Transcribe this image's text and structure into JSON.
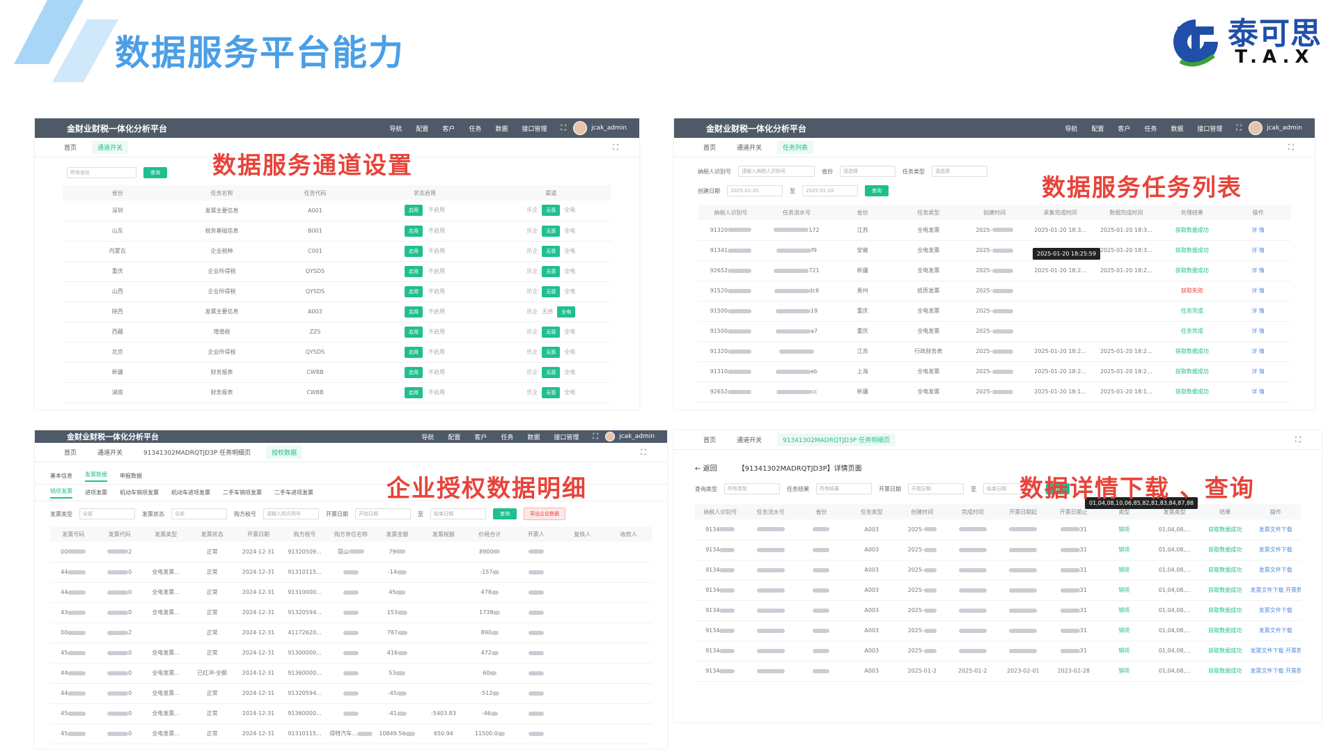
{
  "slide": {
    "title": "数据服务平台能力"
  },
  "logo": {
    "cn": "泰可思",
    "en": "T.A.X",
    "brand_color": "#1f4fa8",
    "accent_green": "#3aa335"
  },
  "colors": {
    "title": "#4a9fe6",
    "overlay": "#e8433a",
    "topbar": "#4e5a68",
    "accent": "#1fbf8f"
  },
  "app": {
    "name": "金财业财税一体化分析平台",
    "nav": [
      "导航",
      "配置",
      "客户",
      "任务",
      "数据",
      "接口管理"
    ],
    "user": "jcak_admin"
  },
  "panel1": {
    "overlay": "数据服务通道设置",
    "tabs": [
      "首页",
      "通道开关"
    ],
    "filter": {
      "placeholder": "所有省份",
      "button": "查询"
    },
    "headers": [
      "省份",
      "任务名称",
      "任务代码",
      "状态启用",
      "渠道"
    ],
    "rows": [
      {
        "province": "深圳",
        "task": "发票主要信息",
        "code": "A001"
      },
      {
        "province": "山东",
        "task": "税务基础信息",
        "code": "B001"
      },
      {
        "province": "内蒙古",
        "task": "企业税种",
        "code": "C001"
      },
      {
        "province": "重庆",
        "task": "企业所得税",
        "code": "QYSDS"
      },
      {
        "province": "山西",
        "task": "企业所得税",
        "code": "QYSDS"
      },
      {
        "province": "陕西",
        "task": "发票主要信息",
        "code": "A003"
      },
      {
        "province": "西藏",
        "task": "增值税",
        "code": "ZZS"
      },
      {
        "province": "北京",
        "task": "企业所得税",
        "code": "QYSDS"
      },
      {
        "province": "新疆",
        "task": "财务报表",
        "code": "CWBB"
      },
      {
        "province": "湖南",
        "task": "财务报表",
        "code": "CWBB"
      }
    ],
    "btn_on": "启用",
    "btn_off": "不启用",
    "channel_a": "乐企",
    "channel_b": "无感",
    "channel_c": "全电",
    "channel_alt": "无感"
  },
  "panel2": {
    "overlay": "数据服务任务列表",
    "tabs": [
      "首页",
      "通道开关",
      "任务列表"
    ],
    "filter": {
      "taxid_label": "纳税人识别号",
      "taxid_placeholder": "请输入纳税人识别号",
      "province_label": "省份",
      "province_placeholder": "请选择",
      "type_label": "任务类型",
      "type_placeholder": "请选择",
      "date_label": "创建日期",
      "date_from": "2025-01-20",
      "date_sep": "至",
      "date_to": "2025-01-20",
      "button": "查询"
    },
    "headers": [
      "纳税人识别号",
      "任务流水号",
      "省份",
      "任务类型",
      "创建时间",
      "采集完成时间",
      "数据完成时间",
      "处理结果",
      "操作"
    ],
    "tooltip": "2025-01-20 18:25:59",
    "rows": [
      {
        "id": "91320",
        "serial": "172",
        "prov": "江苏",
        "type": "全电发票",
        "created": "2025-",
        "collect": "2025-01-20 18:3...",
        "done": "2025-01-20 18:3...",
        "status": "获取数据成功",
        "status_cls": "st-green"
      },
      {
        "id": "91341",
        "serial": "f9",
        "prov": "安徽",
        "type": "全电发票",
        "created": "2025-",
        "collect": "",
        "done": "2025-01-20 18:3...",
        "status": "获取数据成功",
        "status_cls": "st-green"
      },
      {
        "id": "92652",
        "serial": "721",
        "prov": "新疆",
        "type": "全电发票",
        "created": "2025-",
        "collect": "2025-01-20 18:2...",
        "done": "2025-01-20 18:2...",
        "status": "获取数据成功",
        "status_cls": "st-green"
      },
      {
        "id": "91520",
        "serial": "dc6",
        "prov": "贵州",
        "type": "纸质发票",
        "created": "2025-",
        "collect": "",
        "done": "",
        "status": "获取失败",
        "status_cls": "st-red"
      },
      {
        "id": "91500",
        "serial": "19",
        "prov": "重庆",
        "type": "全电发票",
        "created": "2025-",
        "collect": "",
        "done": "",
        "status": "任务完成",
        "status_cls": "st-green"
      },
      {
        "id": "91500",
        "serial": "a7",
        "prov": "重庆",
        "type": "全电发票",
        "created": "2025-",
        "collect": "",
        "done": "",
        "status": "任务完成",
        "status_cls": "st-green"
      },
      {
        "id": "91320",
        "serial": "",
        "prov": "江苏",
        "type": "行政财务表",
        "created": "2025-",
        "collect": "2025-01-20 18:2...",
        "done": "2025-01-20 18:2...",
        "status": "获取数据成功",
        "status_cls": "st-green"
      },
      {
        "id": "91310",
        "serial": "eb",
        "prov": "上海",
        "type": "全电发票",
        "created": "2025-",
        "collect": "2025-01-20 18:2...",
        "done": "2025-01-20 18:2...",
        "status": "获取数据成功",
        "status_cls": "st-green"
      },
      {
        "id": "92652",
        "serial": "cc",
        "prov": "新疆",
        "type": "全电发票",
        "created": "2025-",
        "collect": "2025-01-20 18:1...",
        "done": "2025-01-20 18:1...",
        "status": "获取数据成功",
        "status_cls": "st-green"
      }
    ],
    "ops": "详 情"
  },
  "panel3": {
    "overlay": "企业授权数据明细",
    "tabs": [
      "首页",
      "通道开关",
      "91341302MADRQTJD3P 任务明细页",
      "授权数据"
    ],
    "subtabs1": [
      "基本信息",
      "发票数据",
      "申报数据"
    ],
    "subtabs2": [
      "销项发票",
      "进项发票",
      "机动车销项发票",
      "机动车进项发票",
      "二手车销项发票",
      "二手车进项发票"
    ],
    "filter": {
      "type_label": "发票类型",
      "type_value": "全部",
      "status_label": "发票状态",
      "status_value": "全部",
      "buyer_label": "购方税号",
      "buyer_placeholder": "请输入购方税号",
      "date_label": "开票日期",
      "date_from": "开始日期",
      "date_sep": "至",
      "date_to": "结束日期",
      "search": "查询",
      "export": "导出企业数据"
    },
    "headers": [
      "发票号码",
      "发票代码",
      "发票类型",
      "发票状态",
      "开票日期",
      "购方税号",
      "购方单位名称",
      "发票金额",
      "发票税额",
      "价税合计",
      "开票人",
      "复核人",
      "收款人"
    ],
    "rows": [
      {
        "no": "00",
        "code": "2",
        "type": "",
        "status": "正常",
        "date": "2024-12-31",
        "tax": "91320509...",
        "name": "昆山",
        "amount": "79",
        "taxamt": "",
        "total": "8900",
        "drawer": ""
      },
      {
        "no": "44",
        "code": "0",
        "type": "全电发票...",
        "status": "正常",
        "date": "2024-12-31",
        "tax": "91310115...",
        "name": "",
        "amount": "-14",
        "taxamt": "",
        "total": "-157",
        "drawer": ""
      },
      {
        "no": "44",
        "code": "0",
        "type": "全电发票...",
        "status": "正常",
        "date": "2024-12-31",
        "tax": "91310000...",
        "name": "",
        "amount": "45",
        "taxamt": "",
        "total": "478",
        "drawer": ""
      },
      {
        "no": "43",
        "code": "0",
        "type": "全电发票...",
        "status": "正常",
        "date": "2024-12-31",
        "tax": "91320594...",
        "name": "",
        "amount": "153",
        "taxamt": "",
        "total": "1738",
        "drawer": ""
      },
      {
        "no": "00",
        "code": "2",
        "type": "",
        "status": "正常",
        "date": "2024-12-31",
        "tax": "41172620...",
        "name": "",
        "amount": "787",
        "taxamt": "",
        "total": "890",
        "drawer": ""
      },
      {
        "no": "45",
        "code": "0",
        "type": "全电发票...",
        "status": "正常",
        "date": "2024-12-31",
        "tax": "91300000...",
        "name": "",
        "amount": "416",
        "taxamt": "",
        "total": "472",
        "drawer": ""
      },
      {
        "no": "44",
        "code": "0",
        "type": "全电发票...",
        "status": "已红冲-全额",
        "date": "2024-12-31",
        "tax": "91360000...",
        "name": "",
        "amount": "53",
        "taxamt": "",
        "total": "60",
        "drawer": ""
      },
      {
        "no": "44",
        "code": "0",
        "type": "全电发票...",
        "status": "正常",
        "date": "2024-12-31",
        "tax": "91320594...",
        "name": "",
        "amount": "-45",
        "taxamt": "",
        "total": "-512",
        "drawer": ""
      },
      {
        "no": "45",
        "code": "0",
        "type": "全电发票...",
        "status": "正常",
        "date": "2024-12-31",
        "tax": "91360000...",
        "name": "",
        "amount": "-41",
        "taxamt": "-5403.83",
        "total": "-46",
        "drawer": ""
      },
      {
        "no": "45",
        "code": "0",
        "type": "全电发票...",
        "status": "正常",
        "date": "2024-12-31",
        "tax": "91310115...",
        "name": "得特汽车...",
        "amount": "10849.56",
        "taxamt": "650.94",
        "total": "11500.0",
        "drawer": ""
      }
    ]
  },
  "panel4": {
    "overlay": "数据详情下载 、查询",
    "tabs": [
      "首页",
      "通道开关",
      "91341302MADRQTJD3P 任务明细页"
    ],
    "back": "返回",
    "page_title": "【91341302MADRQTJD3P】详情页面",
    "filter": {
      "type_label": "查询类型",
      "type_value": "所有类型",
      "result_label": "任务结果",
      "result_value": "所有结果",
      "date_label": "开票日期",
      "date_from": "开始日期",
      "date_sep": "至",
      "date_to": "结束日期",
      "search": "查询"
    },
    "tooltip": "01,04,08,10,06,85,82,81,83,84,87,88",
    "headers": [
      "纳税人识别号",
      "任务流水号",
      "省份",
      "任务类型",
      "创建时间",
      "完成时间",
      "开票日期起",
      "开票日期止",
      "类型",
      "发票类型",
      "结果",
      "操作"
    ],
    "rows": [
      {
        "id": "9134",
        "code": "A003",
        "created": "2025-",
        "end": "31",
        "types": "01,04,08,...",
        "result": "获取数据成功",
        "ops": "发票文件下载"
      },
      {
        "id": "9134",
        "code": "A003",
        "created": "2025-",
        "end": "31",
        "types": "01,04,08,...",
        "result": "获取数据成功",
        "ops": "发票文件下载"
      },
      {
        "id": "9134",
        "code": "A003",
        "created": "2025-",
        "end": "31",
        "types": "01,04,08,...",
        "result": "获取数据成功",
        "ops": "发票文件下载"
      },
      {
        "id": "9134",
        "code": "A003",
        "created": "2025-",
        "end": "31",
        "types": "01,04,08,...",
        "result": "获取数据成功",
        "ops": "发票文件下载  开票数据下载"
      },
      {
        "id": "9134",
        "code": "A003",
        "created": "2025-",
        "end": "31",
        "types": "01,04,08,...",
        "result": "获取数据成功",
        "ops": "发票文件下载"
      },
      {
        "id": "9134",
        "code": "A003",
        "created": "2025-",
        "end": "31",
        "types": "01,04,08,...",
        "result": "获取数据成功",
        "ops": "发票文件下载"
      },
      {
        "id": "9134",
        "code": "A003",
        "created": "2025-",
        "end": "31",
        "types": "01,04,08,...",
        "result": "获取数据成功",
        "ops": "发票文件下载  开票数据下载"
      },
      {
        "id": "9134",
        "code": "A003",
        "created": "2025-01-2",
        "end": "2023-02-28",
        "types": "01,04,08,...",
        "result": "获取数据成功",
        "ops": "发票文件下载  开票数据下载"
      }
    ],
    "last_row": {
      "complete": "2025-01-2",
      "start": "2023-02-01"
    },
    "type_tag": "销项"
  }
}
